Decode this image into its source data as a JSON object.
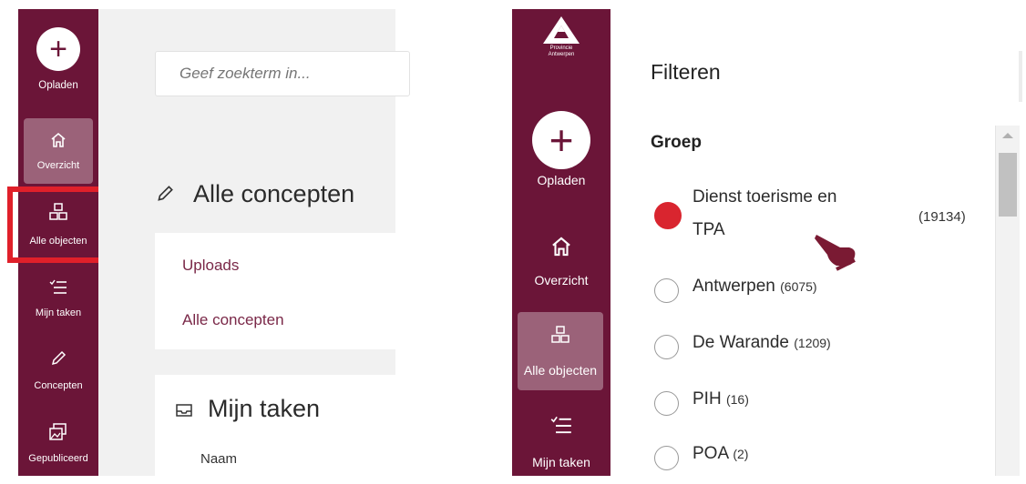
{
  "left": {
    "sidebar": {
      "upload_label": "Opladen",
      "items": [
        {
          "label": "Overzicht",
          "icon": "home-icon"
        },
        {
          "label": "Alle objecten",
          "icon": "objects-icon"
        },
        {
          "label": "Mijn taken",
          "icon": "tasks-icon"
        },
        {
          "label": "Concepten",
          "icon": "pencil-icon"
        },
        {
          "label": "Gepubliceerd",
          "icon": "published-icon"
        }
      ]
    },
    "search": {
      "placeholder": "Geef zoekterm in..."
    },
    "concepts": {
      "title": "Alle concepten",
      "links": [
        "Uploads",
        "Alle concepten"
      ]
    },
    "tasks": {
      "title": "Mijn taken",
      "column": "Naam"
    },
    "highlight_color": "#e0202a"
  },
  "right": {
    "sidebar": {
      "logo_line1": "Provincie",
      "logo_line2": "Antwerpen",
      "upload_label": "Opladen",
      "items": [
        {
          "label": "Overzicht",
          "icon": "home-icon"
        },
        {
          "label": "Alle objecten",
          "icon": "objects-icon"
        },
        {
          "label": "Mijn taken",
          "icon": "tasks-icon"
        }
      ]
    },
    "filter": {
      "title": "Filteren",
      "group_title": "Groep",
      "options": [
        {
          "line1": "Dienst toerisme en",
          "line2": "TPA",
          "count": "(19134)",
          "selected": true
        },
        {
          "label": "Antwerpen",
          "count": "(6075)",
          "selected": false
        },
        {
          "label": "De Warande",
          "count": "(1209)",
          "selected": false
        },
        {
          "label": "PIH",
          "count": "(16)",
          "selected": false
        },
        {
          "label": "POA",
          "count": "(2)",
          "selected": false
        }
      ]
    }
  },
  "colors": {
    "brand": "#6b1538",
    "accent": "#d9252f"
  }
}
